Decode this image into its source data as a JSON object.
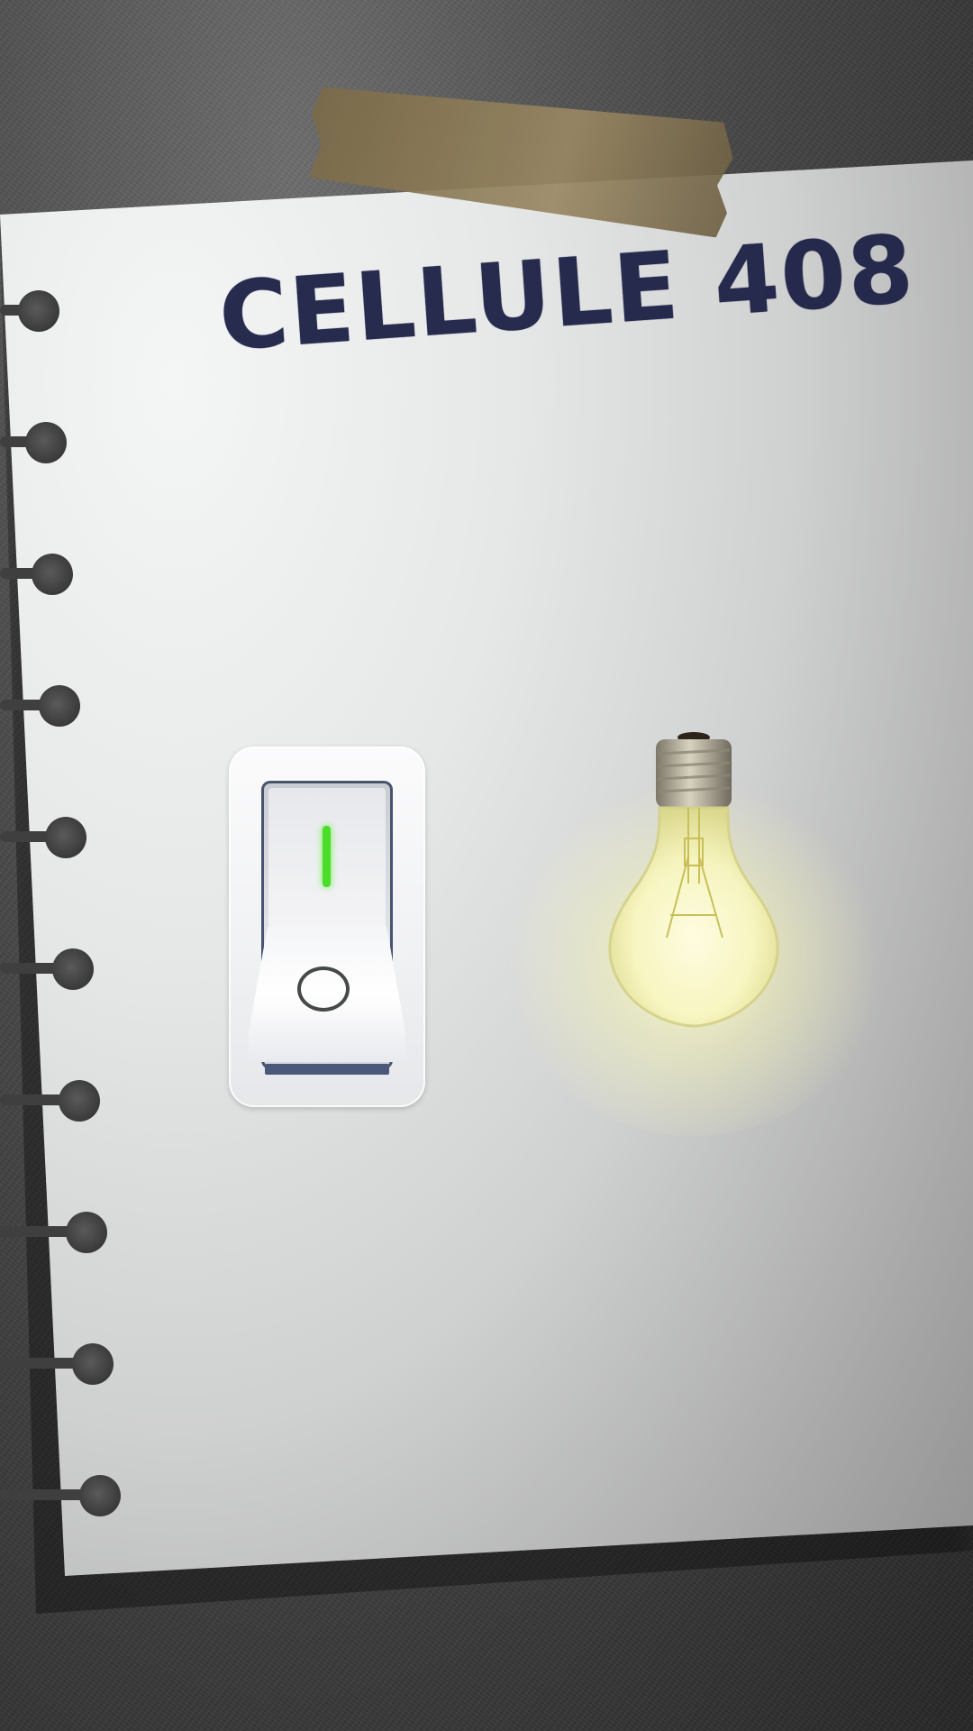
{
  "title": "CELLULE 408",
  "switch": {
    "state": "on",
    "on_color": "#4cdd2a"
  },
  "bulb": {
    "state": "lit",
    "glow_color": "#fff7b0"
  },
  "colors": {
    "title": "#1d2146",
    "paper": "#e6e8e8",
    "tape": "#8c7b57",
    "background": "#3a3a3a"
  },
  "icons": {
    "switch": "rocker-switch-icon",
    "bulb": "light-bulb-icon"
  }
}
